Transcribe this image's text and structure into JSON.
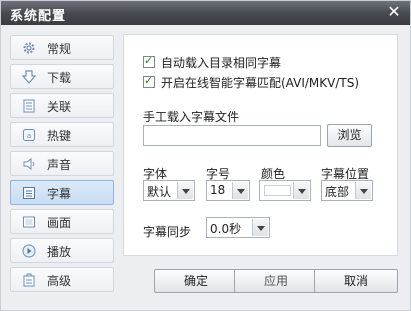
{
  "window": {
    "title": "系统配置"
  },
  "sidebar": {
    "items": [
      {
        "label": "常规",
        "icon": "gear-icon"
      },
      {
        "label": "下载",
        "icon": "download-icon"
      },
      {
        "label": "关联",
        "icon": "document-icon"
      },
      {
        "label": "热键",
        "icon": "key-icon"
      },
      {
        "label": "声音",
        "icon": "speaker-icon"
      },
      {
        "label": "字幕",
        "icon": "subtitle-icon",
        "active": true
      },
      {
        "label": "画面",
        "icon": "screen-icon"
      },
      {
        "label": "播放",
        "icon": "play-icon"
      },
      {
        "label": "高级",
        "icon": "advanced-icon"
      }
    ]
  },
  "subtitle": {
    "auto_load_label": "自动载入目录相同字幕",
    "auto_load_checked": true,
    "online_match_label": "开启在线智能字幕匹配(AVI/MKV/TS)",
    "online_match_checked": true,
    "manual_load_label": "手工载入字幕文件",
    "file_path": "",
    "browse_label": "浏览",
    "font_label": "字体",
    "font_value": "默认",
    "size_label": "字号",
    "size_value": "18",
    "color_label": "颜色",
    "color_value": "#ffffff",
    "position_label": "字幕位置",
    "position_value": "底部",
    "sync_label": "字幕同步",
    "sync_value": "0.0秒"
  },
  "footer": {
    "ok_label": "确定",
    "apply_label": "应用",
    "cancel_label": "取消"
  },
  "colors": {
    "accent": "#c8ddf3",
    "titlebar": "#45484e"
  }
}
